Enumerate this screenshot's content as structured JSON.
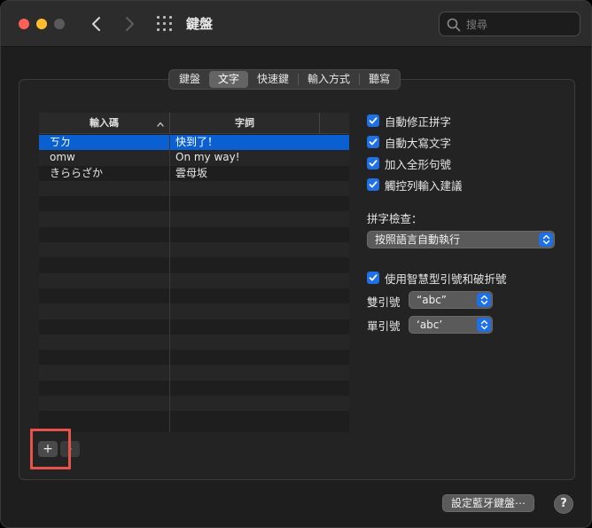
{
  "window": {
    "title": "鍵盤",
    "search_placeholder": "搜尋"
  },
  "tabs": [
    {
      "label": "鍵盤",
      "active": false
    },
    {
      "label": "文字",
      "active": true
    },
    {
      "label": "快速鍵",
      "active": false
    },
    {
      "label": "輸入方式",
      "active": false
    },
    {
      "label": "聽寫",
      "active": false
    }
  ],
  "table": {
    "col1_header": "輸入碼",
    "col1_sort_indicator": "^",
    "col2_header": "字詞",
    "rows": [
      {
        "replace": "ㄎㄉ",
        "with": "快到了！",
        "selected": true
      },
      {
        "replace": "omw",
        "with": "On my way!",
        "selected": false
      },
      {
        "replace": "きららざか",
        "with": "雲母坂",
        "selected": false
      }
    ],
    "empty_rows": 16
  },
  "buttons": {
    "add": "+",
    "remove": "-",
    "bluetooth_keyboard": "設定藍牙鍵盤⋯",
    "help": "?"
  },
  "options": {
    "checkboxes": [
      {
        "label": "自動修正拼字",
        "checked": true
      },
      {
        "label": "自動大寫文字",
        "checked": true
      },
      {
        "label": "加入全形句號",
        "checked": true
      },
      {
        "label": "觸控列輸入建議",
        "checked": true
      }
    ],
    "spelling_label": "拼字檢查：",
    "spelling_value": "按照語言自動執行",
    "smart_quotes_label": "使用智慧型引號和破折號",
    "smart_quotes_checked": true,
    "double_quotes_label": "雙引號",
    "double_quotes_value": "“abc”",
    "single_quotes_label": "單引號",
    "single_quotes_value": "‘abc’"
  },
  "colors": {
    "accent": "#1f6fe5",
    "selection": "#0a5fd1",
    "highlight_box": "#e5534b"
  }
}
